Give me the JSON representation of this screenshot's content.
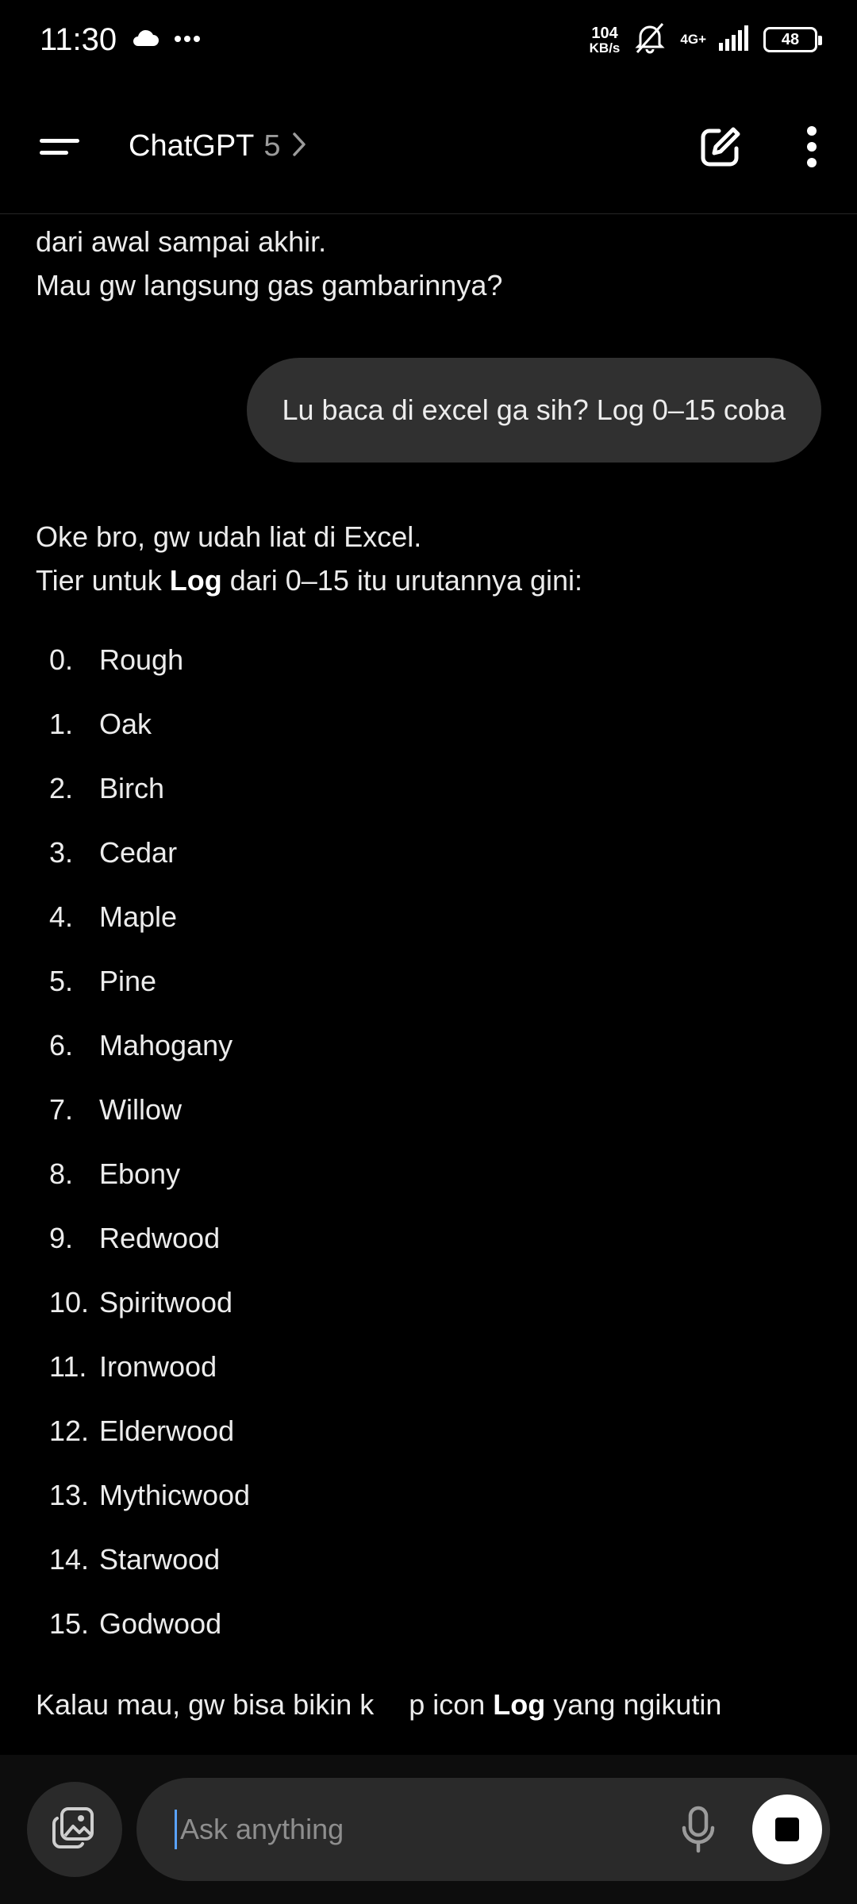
{
  "status_bar": {
    "time": "11:30",
    "net_speed_value": "104",
    "net_speed_unit": "KB/s",
    "network": "4G+",
    "battery": "48",
    "icons": [
      "cloud-icon",
      "more-dots-icon",
      "mute-icon",
      "signal-icon",
      "battery-icon"
    ]
  },
  "header": {
    "title": "ChatGPT",
    "model": "5",
    "icons": [
      "menu-icon",
      "chevron-right-icon",
      "new-chat-icon",
      "more-vertical-icon"
    ]
  },
  "chat": {
    "assistant_top_lines": [
      "dari awal sampai akhir.",
      "Mau gw langsung gas gambarinnya?"
    ],
    "user_message": "Lu baca di excel ga sih? Log 0–15 coba",
    "assistant_intro_line1": "Oke bro, gw udah liat di Excel.",
    "assistant_intro_line2_pre": "Tier untuk ",
    "assistant_intro_line2_bold": "Log",
    "assistant_intro_line2_post": " dari 0–15 itu urutannya gini:",
    "tiers": [
      {
        "num": "0.",
        "name": "Rough"
      },
      {
        "num": "1.",
        "name": "Oak"
      },
      {
        "num": "2.",
        "name": "Birch"
      },
      {
        "num": "3.",
        "name": "Cedar"
      },
      {
        "num": "4.",
        "name": "Maple"
      },
      {
        "num": "5.",
        "name": "Pine"
      },
      {
        "num": "6.",
        "name": "Mahogany"
      },
      {
        "num": "7.",
        "name": "Willow"
      },
      {
        "num": "8.",
        "name": "Ebony"
      },
      {
        "num": "9.",
        "name": "Redwood"
      },
      {
        "num": "10.",
        "name": "Spiritwood"
      },
      {
        "num": "11.",
        "name": "Ironwood"
      },
      {
        "num": "12.",
        "name": "Elderwood"
      },
      {
        "num": "13.",
        "name": "Mythicwood"
      },
      {
        "num": "14.",
        "name": "Starwood"
      },
      {
        "num": "15.",
        "name": "Godwood"
      }
    ],
    "outro_pre": "Kalau mau, gw bisa bikin k",
    "outro_mid": "p icon ",
    "outro_bold": "Log",
    "outro_post": " yang ngikutin",
    "scroll_icon": "arrow-down-icon"
  },
  "composer": {
    "placeholder": "Ask anything",
    "icons": [
      "image-attach-icon",
      "mic-icon",
      "stop-icon"
    ]
  }
}
